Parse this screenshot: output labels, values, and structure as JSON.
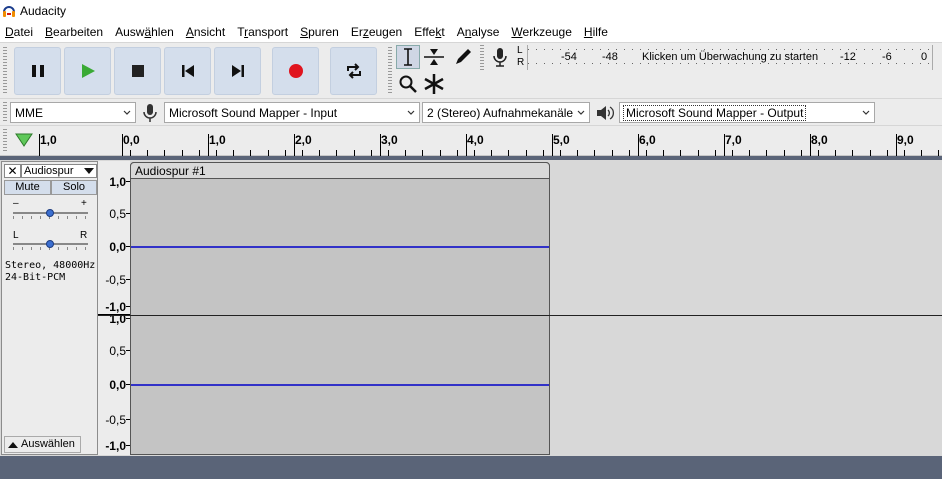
{
  "app": {
    "title": "Audacity"
  },
  "menu": [
    {
      "pre": "",
      "u": "D",
      "post": "atei"
    },
    {
      "pre": "",
      "u": "B",
      "post": "earbeiten"
    },
    {
      "pre": "Ausw",
      "u": "ä",
      "post": "hlen"
    },
    {
      "pre": "",
      "u": "A",
      "post": "nsicht"
    },
    {
      "pre": "T",
      "u": "r",
      "post": "ansport"
    },
    {
      "pre": "",
      "u": "S",
      "post": "puren"
    },
    {
      "pre": "Er",
      "u": "z",
      "post": "eugen"
    },
    {
      "pre": "Effe",
      "u": "k",
      "post": "t"
    },
    {
      "pre": "A",
      "u": "n",
      "post": "alyse"
    },
    {
      "pre": "",
      "u": "W",
      "post": "erkzeuge"
    },
    {
      "pre": "",
      "u": "H",
      "post": "ilfe"
    }
  ],
  "transport": {
    "buttons": [
      "pause-icon",
      "play-icon",
      "stop-icon",
      "skip-start-icon",
      "skip-end-icon",
      "record-icon",
      "loop-icon"
    ],
    "play_color": "#3aaa35",
    "record_color": "#e0141e"
  },
  "meter": {
    "l": "L",
    "r": "R",
    "ticks": [
      "-54",
      "-48",
      "-12",
      "-6",
      "0"
    ],
    "prompt": "Klicken um Überwachung zu starten"
  },
  "devices": {
    "host": "MME",
    "input": "Microsoft Sound Mapper - Input",
    "channels": "2 (Stereo) Aufnahmekanäle",
    "output": "Microsoft Sound Mapper - Output"
  },
  "ruler": {
    "labels": [
      "1,0",
      "0,0",
      "1,0",
      "2,0",
      "3,0",
      "4,0",
      "5,0",
      "6,0",
      "7,0",
      "8,0",
      "9,0"
    ]
  },
  "track": {
    "name": "Audiospur",
    "mute": "Mute",
    "solo": "Solo",
    "gain_minus": "–",
    "gain_plus": "+",
    "pan_l": "L",
    "pan_r": "R",
    "info1": "Stereo, 48000Hz",
    "info2": "24-Bit-PCM",
    "select": "Auswählen",
    "clip_name": "Audiospur #1"
  },
  "scale": {
    "labels": [
      "1,0",
      "0,5",
      "0,0",
      "-0,5",
      "-1,0"
    ]
  },
  "colors": {
    "waveform": "#3232c8",
    "toolbar_button": "#d4deec",
    "bottom_bar": "#5a6478"
  }
}
